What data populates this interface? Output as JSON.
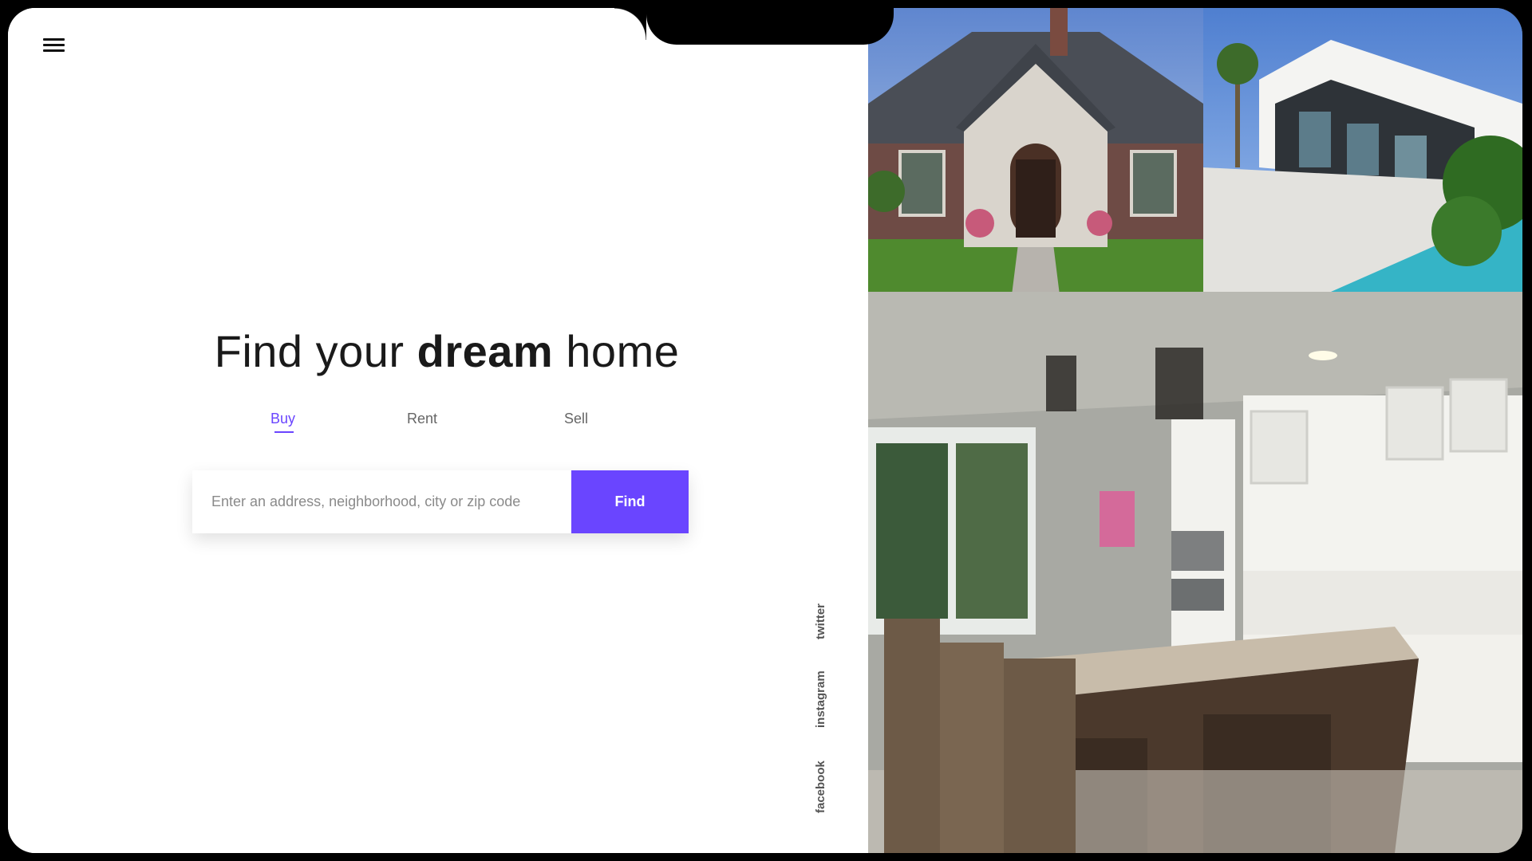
{
  "menu": {
    "icon": "hamburger-menu-icon"
  },
  "hero": {
    "title_prefix": "Find your",
    "title_emphasis": "dream",
    "title_suffix": "home"
  },
  "tabs": [
    {
      "label": "Buy",
      "active": true
    },
    {
      "label": "Rent",
      "active": false
    },
    {
      "label": "Sell",
      "active": false
    }
  ],
  "search": {
    "placeholder": "Enter an address, neighborhood, city or zip code",
    "value": "",
    "button_label": "Find"
  },
  "social": [
    {
      "label": "twitter"
    },
    {
      "label": "instagram"
    },
    {
      "label": "facebook"
    }
  ],
  "colors": {
    "accent": "#6a45ff",
    "text": "#1a1a1a",
    "muted": "#666666"
  }
}
